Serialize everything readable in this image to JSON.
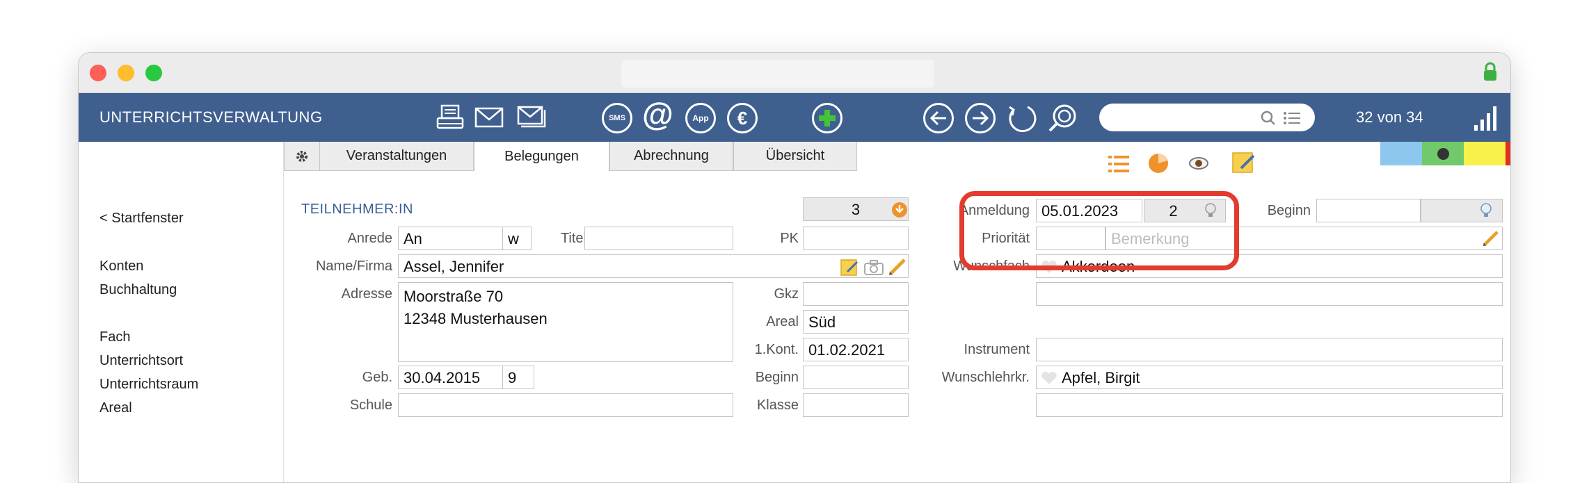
{
  "toolbar": {
    "app_title": "UNTERRICHTSVERWALTUNG",
    "record_counter": "32 von 34",
    "search_placeholder": ""
  },
  "sidebar": {
    "back_link": "< Startfenster",
    "items": [
      "Konten",
      "Buchhaltung",
      "Fach",
      "Unterrichtsort",
      "Unterrichtsraum",
      "Areal"
    ]
  },
  "tabs": [
    "Veranstaltungen",
    "Belegungen",
    "Abrechnung",
    "Übersicht"
  ],
  "section_title": "TEILNEHMER:IN",
  "form": {
    "record_number": "3",
    "anrede_label": "Anrede",
    "anrede": "An",
    "gender": "w",
    "titel_label": "Titel",
    "titel": "",
    "pk_label": "PK",
    "pk": "",
    "name_label": "Name/Firma",
    "name": "Assel, Jennifer",
    "adresse_label": "Adresse",
    "adresse_line1": "Moorstraße 70",
    "adresse_line2": "12348 Musterhausen",
    "gkz_label": "Gkz",
    "gkz": "",
    "areal_label": "Areal",
    "areal": "Süd",
    "kontakt_label": "1.Kont.",
    "kontakt": "01.02.2021",
    "geb_label": "Geb.",
    "geb": "30.04.2015",
    "age": "9",
    "beginn_label": "Beginn",
    "beginn": "",
    "schule_label": "Schule",
    "schule": "",
    "klasse_label": "Klasse",
    "klasse": ""
  },
  "right_form": {
    "anmeldung_label": "Anmeldung",
    "anmeldung": "05.01.2023",
    "anmeldung_count": "2",
    "beginn_label": "Beginn",
    "beginn": "",
    "prioritaet_label": "Priorität",
    "prioritaet": "",
    "bemerkung_placeholder": "Bemerkung",
    "wunschfach_label": "Wunschfach",
    "wunschfach": "Akkordeon",
    "instrument_label": "Instrument",
    "instrument": "",
    "wunschlehrer_label": "Wunschlehrkr.",
    "wunschlehrer": "Apfel, Birgit"
  },
  "colors": {
    "toolbar_bg": "#3f5f8f",
    "highlight_red": "#e33b2e",
    "accent_orange": "#f0922b",
    "swatches": [
      "#8ec7ee",
      "#70c96a",
      "#f7f14b",
      "#e32c22",
      "#8f8f8f"
    ]
  },
  "icons": [
    "gear-icon",
    "printer-icon",
    "mail-icon",
    "mail-multi-icon",
    "sms-icon",
    "at-icon",
    "app-icon",
    "euro-icon",
    "add-icon",
    "back-icon",
    "forward-icon",
    "refresh-icon",
    "zoom-icon",
    "search-icon",
    "list-icon",
    "signal-icon",
    "lock-icon",
    "list-view-icon",
    "pie-icon",
    "eye-icon",
    "note-icon",
    "camera-icon",
    "pencil-icon",
    "bulb-icon",
    "heart-icon"
  ]
}
